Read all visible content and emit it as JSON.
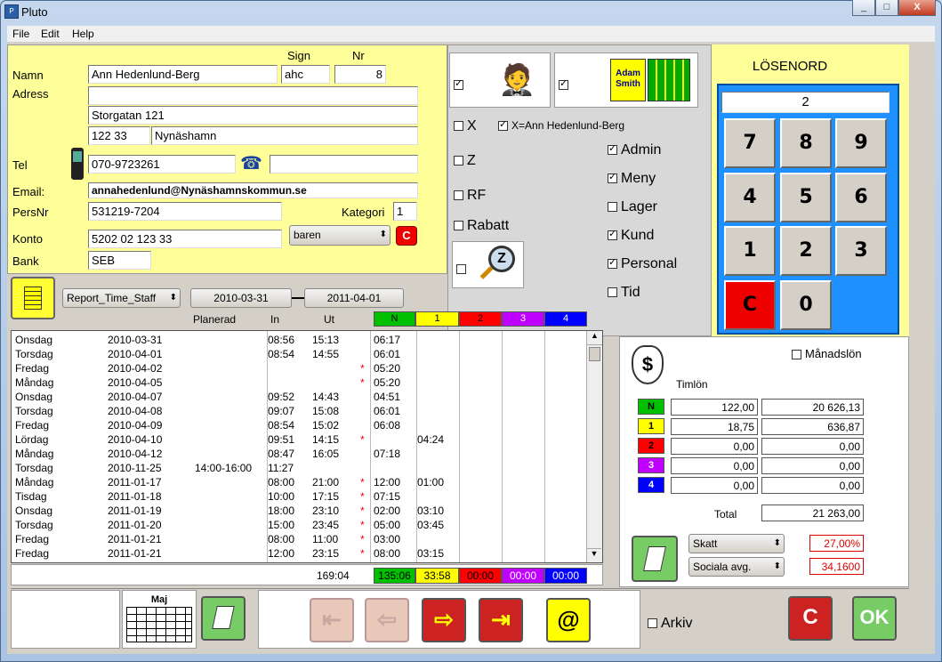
{
  "window": {
    "title": "Pluto",
    "min": "_",
    "max": "□",
    "close": "X"
  },
  "menu": [
    "File",
    "Edit",
    "Help"
  ],
  "person": {
    "sign_label": "Sign",
    "nr_label": "Nr",
    "namn_label": "Namn",
    "namn": "Ann Hedenlund-Berg",
    "sign": "ahc",
    "nr": "8",
    "adress_label": "Adress",
    "adress1": "",
    "adress2": "Storgatan 121",
    "postnr": "122 33",
    "ort": "Nynäshamn",
    "tel_label": "Tel",
    "tel": "070-9723261",
    "tel2": "",
    "email_label": "Email:",
    "email": "annahedenlund@Nynäshamnskommun.se",
    "persnr_label": "PersNr",
    "persnr": "531219-7204",
    "kategori_label": "Kategori",
    "kategori": "1",
    "konto_label": "Konto",
    "konto": "5202 02 123 33",
    "konto_select": "baren",
    "c_label": "C",
    "bank_label": "Bank",
    "bank": "SEB"
  },
  "permissions": {
    "adam_text": "Adam Smith",
    "x_label": "X",
    "x_name": "X=Ann Hedenlund-Berg",
    "z_label": "Z",
    "rf_label": "RF",
    "rabatt_label": "Rabatt",
    "z_icon": "Z",
    "items": [
      {
        "label": "Admin",
        "checked": true
      },
      {
        "label": "Meny",
        "checked": true
      },
      {
        "label": "Lager",
        "checked": false
      },
      {
        "label": "Kund",
        "checked": true
      },
      {
        "label": "Personal",
        "checked": true
      },
      {
        "label": "Tid",
        "checked": false
      }
    ]
  },
  "login": {
    "title": "LÖSENORD",
    "value": "2",
    "keys": [
      "7",
      "8",
      "9",
      "4",
      "5",
      "6",
      "1",
      "2",
      "3",
      "C",
      "0"
    ]
  },
  "report": {
    "select": "Report_Time_Staff",
    "date_from": "2010-03-31",
    "date_to": "2011-04-01",
    "hdr_planerad": "Planerad",
    "hdr_in": "In",
    "hdr_ut": "Ut",
    "levels": [
      "N",
      "1",
      "2",
      "3",
      "4"
    ],
    "level_colors": [
      "#00c000",
      "#ffff00",
      "#ff0000",
      "#c000ff",
      "#0000ff"
    ],
    "rows": [
      [
        "Onsdag",
        "2010-03-31",
        "",
        "08:56",
        "15:13",
        "",
        "06:17",
        ""
      ],
      [
        "Torsdag",
        "2010-04-01",
        "",
        "08:54",
        "14:55",
        "",
        "06:01",
        ""
      ],
      [
        "Fredag",
        "2010-04-02",
        "",
        "",
        "",
        "*",
        "05:20",
        ""
      ],
      [
        "Måndag",
        "2010-04-05",
        "",
        "",
        "",
        "*",
        "05:20",
        ""
      ],
      [
        "Onsdag",
        "2010-04-07",
        "",
        "09:52",
        "14:43",
        "",
        "04:51",
        ""
      ],
      [
        "Torsdag",
        "2010-04-08",
        "",
        "09:07",
        "15:08",
        "",
        "06:01",
        ""
      ],
      [
        "Fredag",
        "2010-04-09",
        "",
        "08:54",
        "15:02",
        "",
        "06:08",
        ""
      ],
      [
        "Lördag",
        "2010-04-10",
        "",
        "09:51",
        "14:15",
        "*",
        "",
        "04:24"
      ],
      [
        "Måndag",
        "2010-04-12",
        "",
        "08:47",
        "16:05",
        "",
        "07:18",
        ""
      ],
      [
        "Torsdag",
        "2010-11-25",
        "14:00-16:00",
        "11:27",
        "",
        "",
        "",
        ""
      ],
      [
        "Måndag",
        "2011-01-17",
        "",
        "08:00",
        "21:00",
        "*",
        "12:00",
        "01:00"
      ],
      [
        "Tisdag",
        "2011-01-18",
        "",
        "10:00",
        "17:15",
        "*",
        "07:15",
        ""
      ],
      [
        "Onsdag",
        "2011-01-19",
        "",
        "18:00",
        "23:10",
        "*",
        "02:00",
        "03:10"
      ],
      [
        "Torsdag",
        "2011-01-20",
        "",
        "15:00",
        "23:45",
        "*",
        "05:00",
        "03:45"
      ],
      [
        "Fredag",
        "2011-01-21",
        "",
        "08:00",
        "11:00",
        "*",
        "03:00",
        ""
      ],
      [
        "Fredag",
        "2011-01-21",
        "",
        "12:00",
        "23:15",
        "*",
        "08:00",
        "03:15"
      ]
    ],
    "total": "169:04",
    "sums": [
      "135:06",
      "33:58",
      "00:00",
      "00:00",
      "00:00"
    ]
  },
  "salary": {
    "manadslon_label": "Månadslön",
    "timlon_label": "Timlön",
    "rows": [
      {
        "level": "N",
        "hours": "122,00",
        "amount": "20 626,13"
      },
      {
        "level": "1",
        "hours": "18,75",
        "amount": "636,87"
      },
      {
        "level": "2",
        "hours": "0,00",
        "amount": "0,00"
      },
      {
        "level": "3",
        "hours": "0,00",
        "amount": "0,00"
      },
      {
        "level": "4",
        "hours": "0,00",
        "amount": "0,00"
      }
    ],
    "total_label": "Total",
    "total": "21 263,00",
    "skatt_label": "Skatt",
    "skatt": "27,00%",
    "sociala_label": "Sociala avg.",
    "sociala": "34,1600"
  },
  "footer": {
    "cal_label": "Maj",
    "arkiv_label": "Arkiv",
    "cancel_label": "C",
    "ok_label": "OK",
    "at_label": "@"
  }
}
